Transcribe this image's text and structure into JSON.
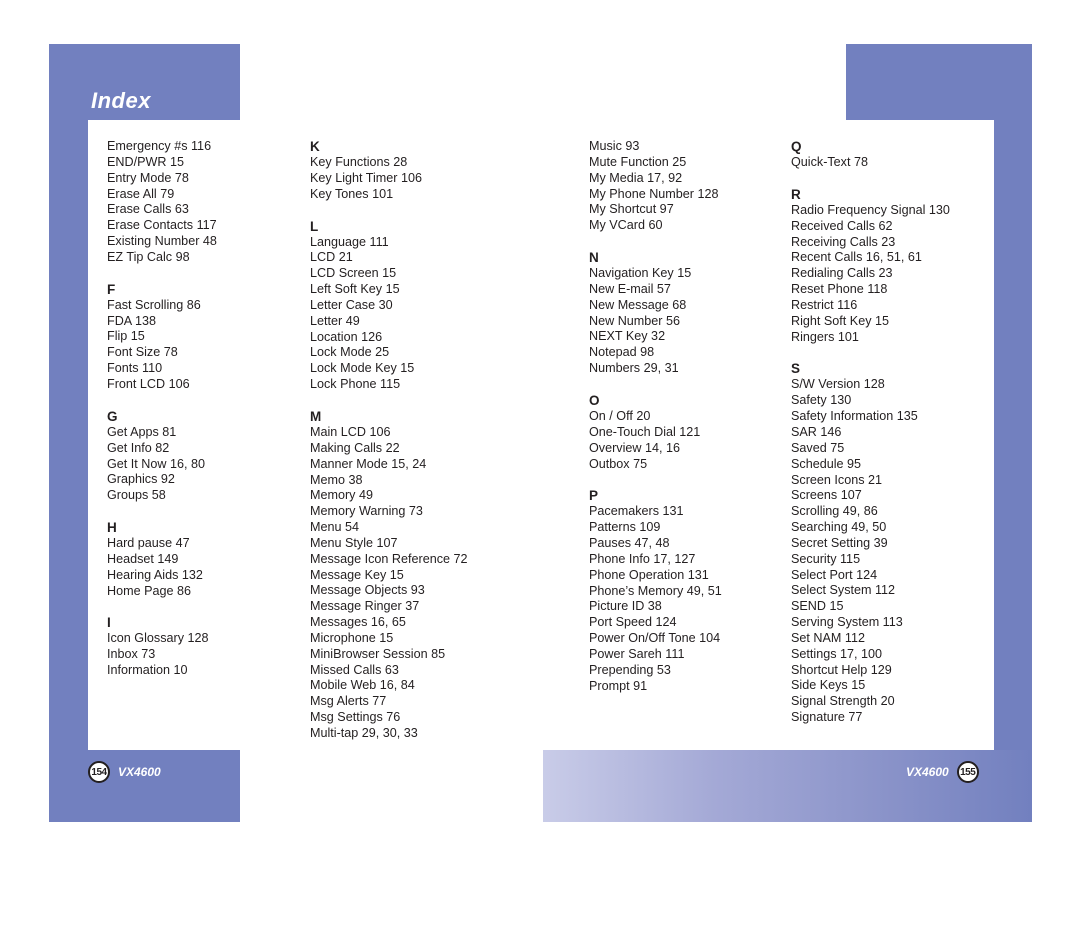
{
  "header": {
    "title": "Index"
  },
  "colors": {
    "frame_blue": "#7280bf",
    "text": "#231f20"
  },
  "columns": [
    {
      "sections": [
        {
          "letter": "",
          "entries": [
            "Emergency #s 116",
            "END/PWR 15",
            "Entry Mode 78",
            "Erase All 79",
            "Erase Calls 63",
            "Erase Contacts 117",
            "Existing Number 48",
            "EZ Tip Calc 98"
          ]
        },
        {
          "letter": "F",
          "entries": [
            "Fast Scrolling 86",
            "FDA 138",
            "Flip 15",
            "Font Size 78",
            "Fonts 110",
            "Front LCD 106"
          ]
        },
        {
          "letter": "G",
          "entries": [
            "Get Apps 81",
            "Get Info 82",
            "Get It Now 16, 80",
            "Graphics 92",
            "Groups 58"
          ]
        },
        {
          "letter": "H",
          "entries": [
            "Hard pause 47",
            "Headset 149",
            "Hearing Aids 132",
            "Home Page 86"
          ]
        },
        {
          "letter": "I",
          "entries": [
            "Icon Glossary 128",
            "Inbox 73",
            "Information 10"
          ]
        }
      ]
    },
    {
      "sections": [
        {
          "letter": "K",
          "entries": [
            "Key Functions 28",
            "Key Light Timer 106",
            "Key Tones 101"
          ]
        },
        {
          "letter": "L",
          "entries": [
            "Language 111",
            "LCD 21",
            "LCD Screen 15",
            "Left Soft Key 15",
            "Letter Case 30",
            "Letter 49",
            "Location 126",
            "Lock Mode 25",
            "Lock Mode Key 15",
            "Lock Phone 115"
          ]
        },
        {
          "letter": "M",
          "entries": [
            "Main LCD 106",
            "Making Calls 22",
            "Manner Mode 15, 24",
            "Memo 38",
            "Memory 49",
            "Memory Warning 73",
            "Menu 54",
            "Menu Style 107",
            "Message Icon Reference 72",
            "Message Key 15",
            "Message Objects 93",
            "Message Ringer 37",
            "Messages 16, 65",
            "Microphone 15",
            "MiniBrowser Session 85",
            "Missed Calls 63",
            "Mobile Web 16, 84",
            "Msg Alerts 77",
            "Msg Settings 76",
            "Multi-tap 29, 30, 33"
          ]
        }
      ]
    },
    {
      "sections": [
        {
          "letter": "",
          "entries": [
            "Music 93",
            "Mute Function 25",
            "My Media 17, 92",
            "My Phone Number 128",
            "My Shortcut 97",
            "My VCard 60"
          ]
        },
        {
          "letter": "N",
          "entries": [
            "Navigation Key 15",
            "New E-mail 57",
            "New Message 68",
            "New Number 56",
            "NEXT Key 32",
            "Notepad 98",
            "Numbers 29, 31"
          ]
        },
        {
          "letter": "O",
          "entries": [
            "On / Off 20",
            "One-Touch Dial 121",
            "Overview 14, 16",
            "Outbox 75"
          ]
        },
        {
          "letter": "P",
          "entries": [
            "Pacemakers 131",
            "Patterns 109",
            "Pauses 47, 48",
            "Phone Info 17, 127",
            "Phone Operation 131",
            "Phone’s Memory 49, 51",
            "Picture ID 38",
            "Port Speed 124",
            "Power On/Off Tone 104",
            "Power Sareh 111",
            "Prepending 53",
            "Prompt 91"
          ]
        }
      ]
    },
    {
      "sections": [
        {
          "letter": "Q",
          "entries": [
            "Quick-Text 78"
          ]
        },
        {
          "letter": "R",
          "entries": [
            "Radio Frequency Signal 130",
            "Received Calls 62",
            "Receiving Calls 23",
            "Recent Calls 16, 51, 61",
            "Redialing Calls 23",
            "Reset Phone 118",
            "Restrict 116",
            "Right Soft Key 15",
            "Ringers 101"
          ]
        },
        {
          "letter": "S",
          "entries": [
            "S/W Version 128",
            "Safety 130",
            "Safety Information 135",
            "SAR 146",
            "Saved 75",
            "Schedule 95",
            "Screen Icons 21",
            "Screens 107",
            "Scrolling 49, 86",
            "Searching 49, 50",
            "Secret Setting 39",
            "Security 115",
            "Select Port 124",
            "Select System 112",
            "SEND 15",
            "Serving System 113",
            "Set NAM 112",
            "Settings 17, 100",
            "Shortcut Help 129",
            "Side Keys 15",
            "Signal Strength 20",
            "Signature 77"
          ]
        }
      ]
    }
  ],
  "footer": {
    "left": {
      "page_number": "154",
      "model": "VX4600"
    },
    "right": {
      "page_number": "155",
      "model": "VX4600"
    }
  }
}
